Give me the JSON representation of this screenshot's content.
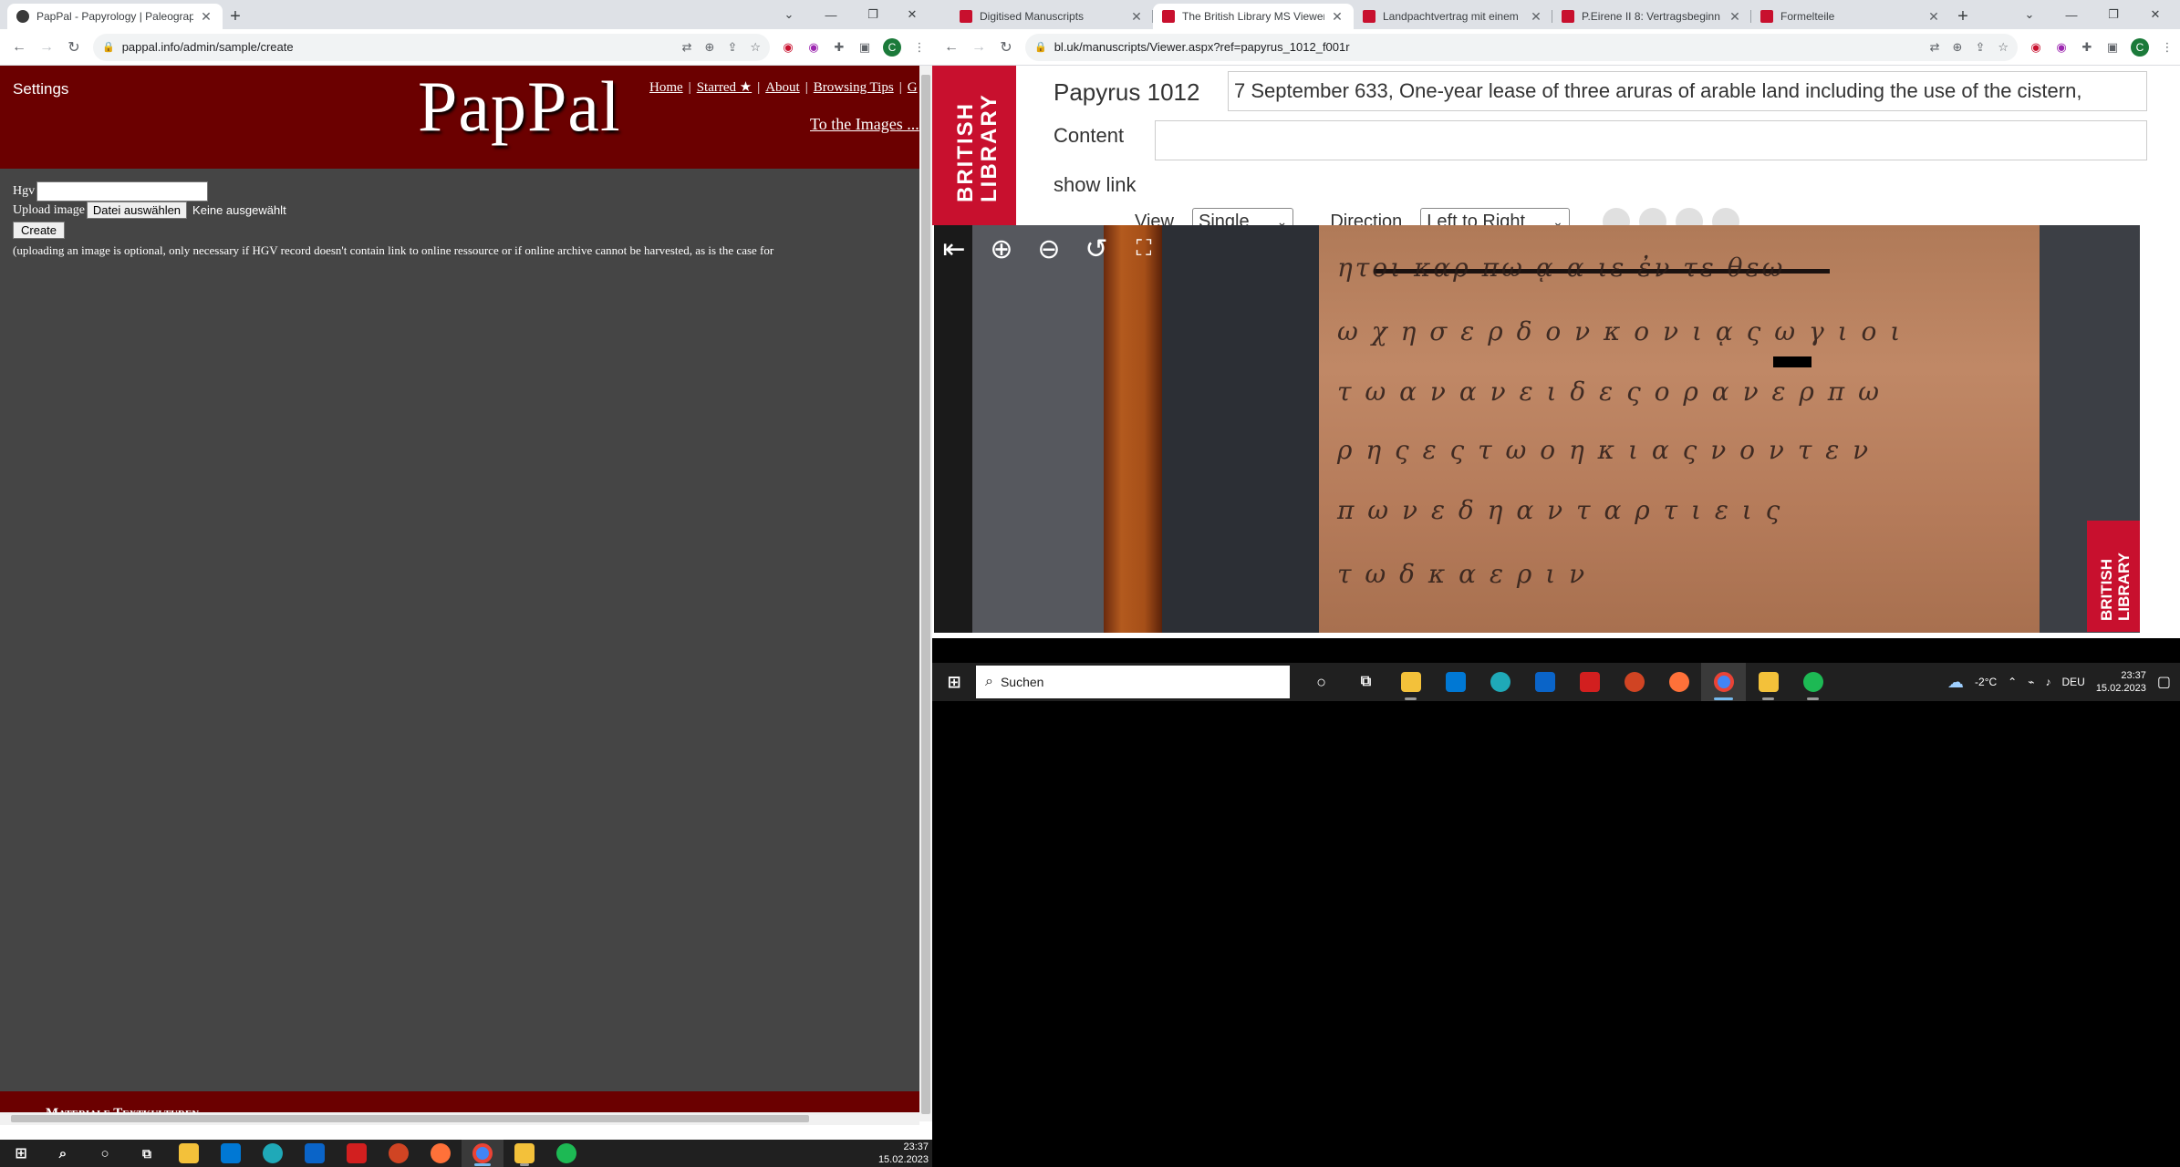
{
  "left_browser": {
    "tabs": [
      {
        "title": "PapPal - Papyrology | Paleography",
        "favicon_color": "#3a3a3a",
        "active": true
      }
    ],
    "url": "pappal.info/admin/sample/create",
    "profile_initial": "C"
  },
  "pappal": {
    "settings_label": "Settings",
    "logo": "PapPal",
    "nav": [
      "Home",
      "Starred ★",
      "About",
      "Browsing Tips"
    ],
    "nav_separator": "|",
    "nav_overflow": "G",
    "to_images": "To the Images ...",
    "form": {
      "hgv_label": "Hgv",
      "upload_label": "Upload image",
      "file_button": "Datei auswählen",
      "no_file": "Keine ausgewählt",
      "create_button": "Create",
      "note": "(uploading an image is optional, only necessary if HGV record doesn't contain link to online ressource or if online archive cannot be harvested, as is the case for"
    },
    "footer_text": "Materiale Textkulturen"
  },
  "left_taskbar": {
    "time": "23:37",
    "date": "15.02.2023"
  },
  "right_browser": {
    "tabs": [
      {
        "title": "Digitised Manuscripts",
        "favicon_color": "#c8102e",
        "active": false
      },
      {
        "title": "The British Library MS Viewer",
        "favicon_color": "#c8102e",
        "active": true
      },
      {
        "title": "Landpachtvertrag mit einem",
        "favicon_color": "#c8102e",
        "active": false
      },
      {
        "title": "P.Eirene II 8: Vertragsbeginn",
        "favicon_color": "#c8102e",
        "active": false
      },
      {
        "title": "Formelteile",
        "favicon_color": "#c8102e",
        "active": false
      }
    ],
    "url": "bl.uk/manuscripts/Viewer.aspx?ref=papyrus_1012_f001r",
    "profile_initial": "C"
  },
  "bl": {
    "logo_lines": [
      "BRITISH",
      "LIBRARY"
    ],
    "title": "Papyrus 1012",
    "description": "7 September 633, One-year lease of three aruras of arable land including the use of the cistern,",
    "content_label": "Content",
    "content_value": "",
    "show_link": "show link",
    "view_label": "View",
    "view_value": "Single",
    "direction_label": "Direction",
    "direction_value": "Left to Right",
    "papyrus_lines": [
      "ητοι καρ πω ᾳ α  ιε ἐν τε θεω",
      "ω χ η  σ ε ρ δ ο ν  κ ο ν ι ᾳ ς ω γ ι ο ι",
      "τ ω α ν  α  ν ε ι δ ε ς ο ρ α ν ε ρ π ω",
      "ρ η ς ε ς τ ω ο  η  κ ι α ς ν ο ν τ ε ν",
      "π ω ν ε  δ  η  α ν τ α ρ τ ι ε ι ς",
      "τ ω  δ  κ α    ε ρ ι ν"
    ]
  },
  "right_taskbar": {
    "search_placeholder": "Suchen",
    "weather": "-2°C",
    "lang": "DEU",
    "time": "23:37",
    "date": "15.02.2023"
  }
}
